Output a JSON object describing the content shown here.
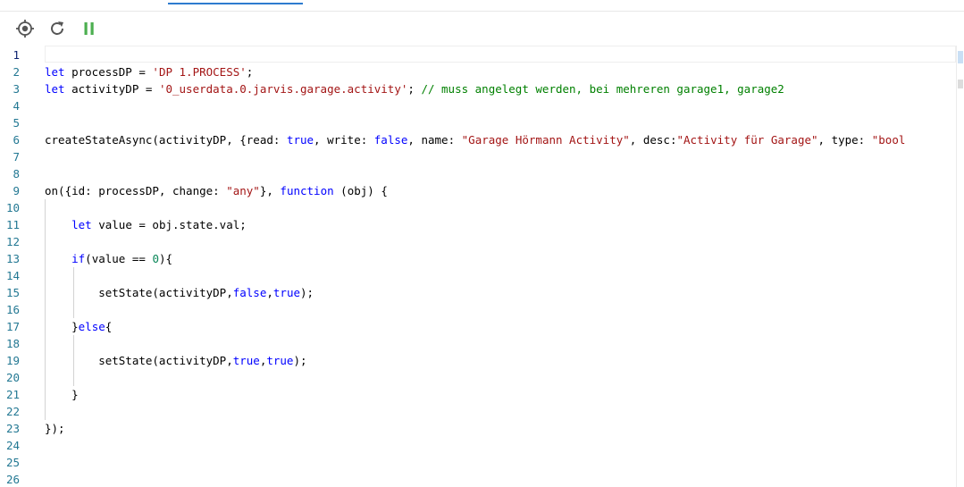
{
  "toolbar": {
    "buttons": [
      {
        "name": "target-button",
        "icon": "crosshair-icon",
        "color": "#555555"
      },
      {
        "name": "restart-button",
        "icon": "refresh-icon",
        "color": "#555555"
      },
      {
        "name": "pause-button",
        "icon": "pause-icon",
        "color": "#4caf50"
      }
    ]
  },
  "editor": {
    "line_numbers": [
      "1",
      "2",
      "3",
      "4",
      "5",
      "6",
      "7",
      "8",
      "9",
      "10",
      "11",
      "12",
      "13",
      "14",
      "15",
      "16",
      "17",
      "18",
      "19",
      "20",
      "21",
      "22",
      "23",
      "24",
      "25",
      "26"
    ],
    "active_line": "1",
    "lines": [
      [],
      [
        {
          "t": "let",
          "c": "kw"
        },
        {
          "t": " processDP = "
        },
        {
          "t": "'DP 1.PROCESS'",
          "c": "str"
        },
        {
          "t": ";"
        }
      ],
      [
        {
          "t": "let",
          "c": "kw"
        },
        {
          "t": " activityDP = "
        },
        {
          "t": "'0_userdata.0.jarvis.garage.activity'",
          "c": "str"
        },
        {
          "t": "; "
        },
        {
          "t": "// muss angelegt werden, bei mehreren garage1, garage2",
          "c": "cmt"
        }
      ],
      [],
      [],
      [
        {
          "t": "createStateAsync(activityDP, {read: "
        },
        {
          "t": "true",
          "c": "kw"
        },
        {
          "t": ", write: "
        },
        {
          "t": "false",
          "c": "kw"
        },
        {
          "t": ", name: "
        },
        {
          "t": "\"Garage Hörmann Activity\"",
          "c": "str"
        },
        {
          "t": ", desc:"
        },
        {
          "t": "\"Activity für Garage\"",
          "c": "str"
        },
        {
          "t": ", type: "
        },
        {
          "t": "\"bool",
          "c": "str"
        }
      ],
      [],
      [],
      [
        {
          "t": "on({id: processDP, change: "
        },
        {
          "t": "\"any\"",
          "c": "str"
        },
        {
          "t": "}, "
        },
        {
          "t": "function",
          "c": "kw"
        },
        {
          "t": " (obj) {"
        }
      ],
      [],
      [
        {
          "t": "    "
        },
        {
          "t": "let",
          "c": "kw"
        },
        {
          "t": " value = obj.state.val;"
        }
      ],
      [],
      [
        {
          "t": "    "
        },
        {
          "t": "if",
          "c": "kw"
        },
        {
          "t": "(value == "
        },
        {
          "t": "0",
          "c": "num"
        },
        {
          "t": "){"
        }
      ],
      [],
      [
        {
          "t": "        setState(activityDP,"
        },
        {
          "t": "false",
          "c": "kw"
        },
        {
          "t": ","
        },
        {
          "t": "true",
          "c": "kw"
        },
        {
          "t": ");"
        }
      ],
      [],
      [
        {
          "t": "    }"
        },
        {
          "t": "else",
          "c": "kw"
        },
        {
          "t": "{"
        }
      ],
      [],
      [
        {
          "t": "        setState(activityDP,"
        },
        {
          "t": "true",
          "c": "kw"
        },
        {
          "t": ","
        },
        {
          "t": "true",
          "c": "kw"
        },
        {
          "t": ");"
        }
      ],
      [],
      [
        {
          "t": "    }"
        }
      ],
      [],
      [
        {
          "t": "});"
        }
      ],
      [],
      [],
      []
    ]
  }
}
